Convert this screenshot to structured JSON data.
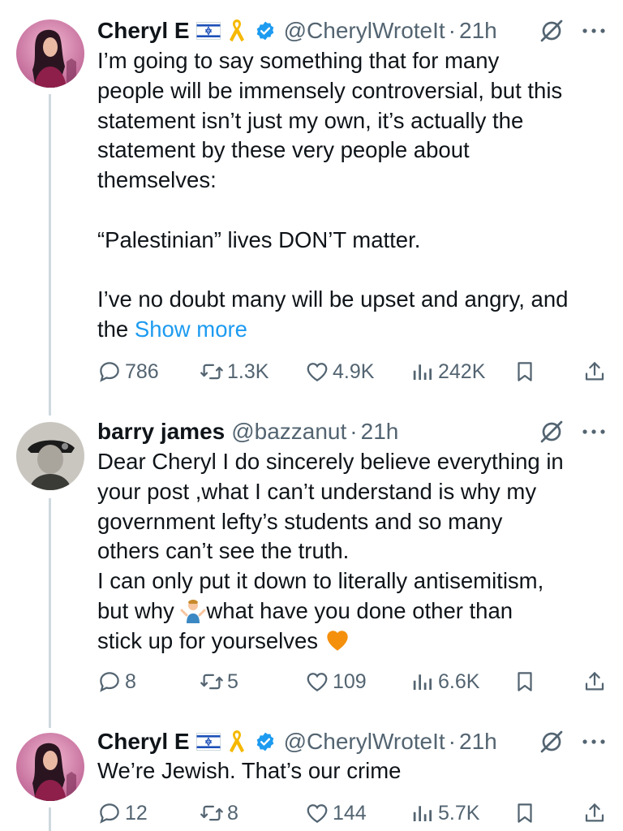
{
  "tweets": [
    {
      "name": "Cheryl E",
      "handle": "@CherylWroteIt",
      "separator": "·",
      "time": "21h",
      "verified": true,
      "badges": [
        "israel-flag-icon",
        "yellow-ribbon-icon"
      ],
      "text_lines": [
        "I’m going to say something that for many",
        "people will be immensely controversial, but this",
        "statement isn’t just my own, it’s actually the",
        "statement by these very people about",
        "themselves:",
        "",
        "“Palestinian” lives DON’T matter.",
        "",
        "I’ve no doubt many will be upset and angry, and"
      ],
      "last_line_prefix": "the ",
      "show_more": "Show more",
      "stats": {
        "replies": "786",
        "reposts": "1.3K",
        "likes": "4.9K",
        "views": "242K"
      }
    },
    {
      "name": "barry james",
      "handle": "@bazzanut",
      "separator": "·",
      "time": "21h",
      "verified": false,
      "text_lines": [
        "Dear Cheryl I do sincerely believe everything in",
        "your post ,what I can’t understand is why my",
        "government lefty’s students and so many",
        "others can’t see the truth.",
        "I can only put it down to literally antisemitism,"
      ],
      "emoji_line_prefix": "but why ",
      "emoji_line_suffix": "what have you done other than",
      "last_line": "stick up for yourselves ",
      "emojis": [
        "person-shrugging-emoji",
        "orange-heart-emoji"
      ],
      "stats": {
        "replies": "8",
        "reposts": "5",
        "likes": "109",
        "views": "6.6K"
      }
    },
    {
      "name": "Cheryl E",
      "handle": "@CherylWroteIt",
      "separator": "·",
      "time": "21h",
      "verified": true,
      "badges": [
        "israel-flag-icon",
        "yellow-ribbon-icon"
      ],
      "text_lines": [
        "We’re Jewish. That’s our crime"
      ],
      "stats": {
        "replies": "12",
        "reposts": "8",
        "likes": "144",
        "views": "5.7K"
      }
    }
  ],
  "colors": {
    "text": "#0f1419",
    "secondary": "#536471",
    "link": "#1d9bf0",
    "verified": "#1d9bf0",
    "thread_line": "#cfd9de"
  }
}
